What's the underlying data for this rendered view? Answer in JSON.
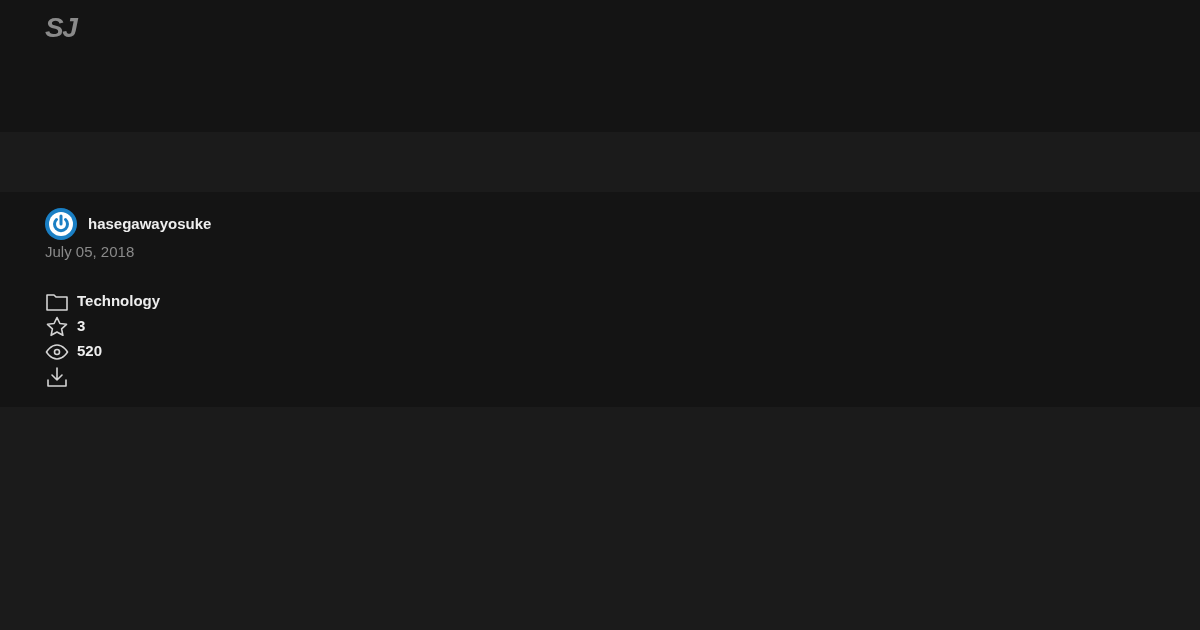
{
  "header": {
    "logo": "SJ"
  },
  "author": {
    "name": "hasegawayosuke",
    "date": "July 05, 2018"
  },
  "meta": [
    {
      "kind": "category",
      "text": "Technology"
    },
    {
      "kind": "stars",
      "text": "3"
    },
    {
      "kind": "views",
      "text": "520"
    },
    {
      "kind": "download"
    }
  ]
}
